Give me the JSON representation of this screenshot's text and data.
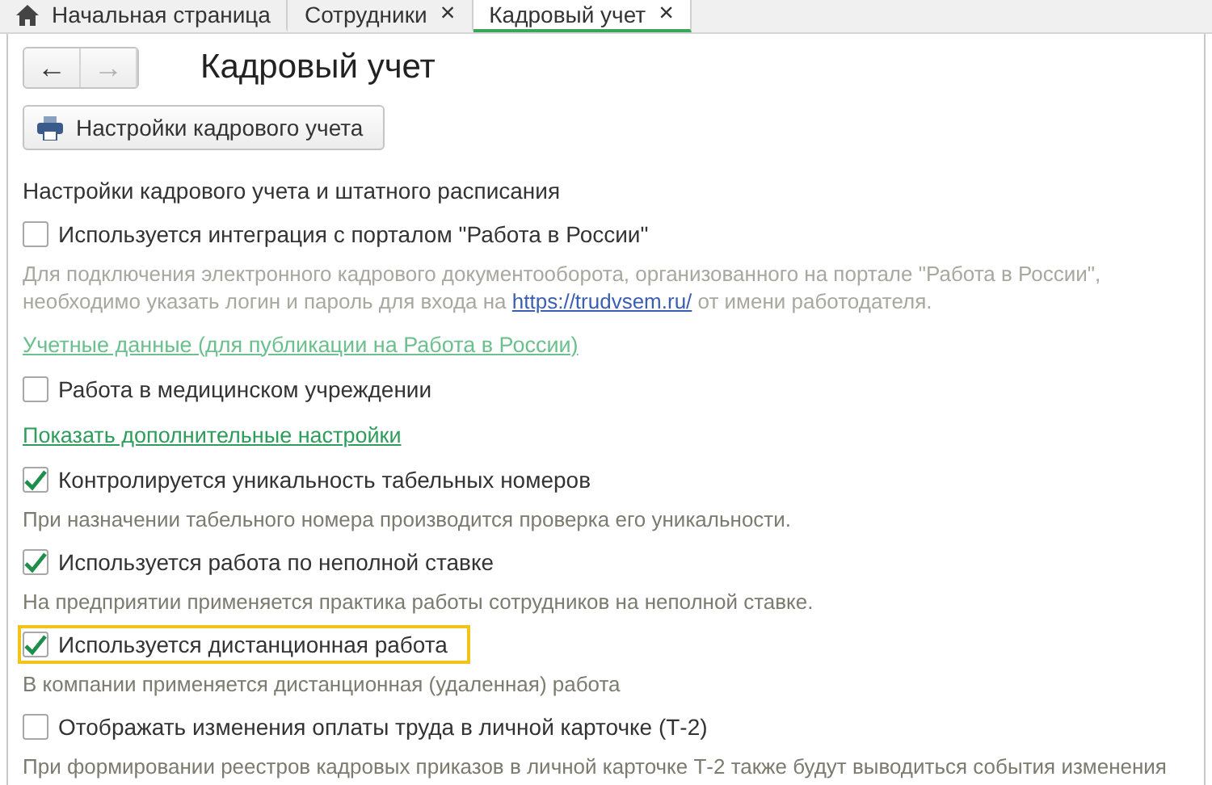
{
  "tabs": [
    {
      "label": "Начальная страница",
      "kind": "home",
      "selected": false
    },
    {
      "label": "Сотрудники",
      "kind": "closable",
      "close": "×",
      "selected": false
    },
    {
      "label": "Кадровый учет",
      "kind": "closable",
      "close": "×",
      "selected": true
    }
  ],
  "nav": {
    "back": "←",
    "forward": "→",
    "forward_disabled": true
  },
  "title": "Кадровый учет",
  "settings_button": "Настройки кадрового учета",
  "section_title": "Настройки кадрового учета и штатного расписания",
  "items": [
    {
      "kind": "checkbox",
      "label": "Используется интеграция с порталом \"Работа в России\"",
      "checked": false,
      "highlighted": false
    },
    {
      "kind": "note",
      "disabled": true,
      "parts": [
        {
          "text": "Для подключения электронного кадрового документооборота, организованного на портале \"Работа в России\", необходимо указать логин и пароль для входа на "
        },
        {
          "text": "https://trudvsem.ru/",
          "link": true
        },
        {
          "text": " от имени работодателя."
        }
      ]
    },
    {
      "kind": "link",
      "label": "Учетные данные (для публикации на Работа в России)",
      "disabled": true
    },
    {
      "kind": "checkbox",
      "label": "Работа в медицинском учреждении",
      "checked": false,
      "highlighted": false
    },
    {
      "kind": "link",
      "label": "Показать дополнительные настройки",
      "disabled": false
    },
    {
      "kind": "checkbox",
      "label": "Контролируется уникальность табельных номеров",
      "checked": true,
      "highlighted": false
    },
    {
      "kind": "note",
      "disabled": false,
      "parts": [
        {
          "text": "При назначении табельного номера производится проверка его уникальности."
        }
      ]
    },
    {
      "kind": "checkbox",
      "label": "Используется работа по неполной ставке",
      "checked": true,
      "highlighted": false
    },
    {
      "kind": "note",
      "disabled": false,
      "parts": [
        {
          "text": "На предприятии применяется практика работы сотрудников на неполной ставке."
        }
      ]
    },
    {
      "kind": "checkbox",
      "label": "Используется дистанционная работа",
      "checked": true,
      "highlighted": true
    },
    {
      "kind": "note",
      "disabled": false,
      "parts": [
        {
          "text": "В компании применяется дистанционная (удаленная) работа"
        }
      ]
    },
    {
      "kind": "checkbox",
      "label": "Отображать изменения оплаты труда в личной карточке (Т-2)",
      "checked": false,
      "highlighted": false
    },
    {
      "kind": "note",
      "disabled": false,
      "parts": [
        {
          "text": "При формировании реестров кадровых приказов в личной карточке Т-2 также будут выводиться события изменения"
        }
      ]
    }
  ]
}
